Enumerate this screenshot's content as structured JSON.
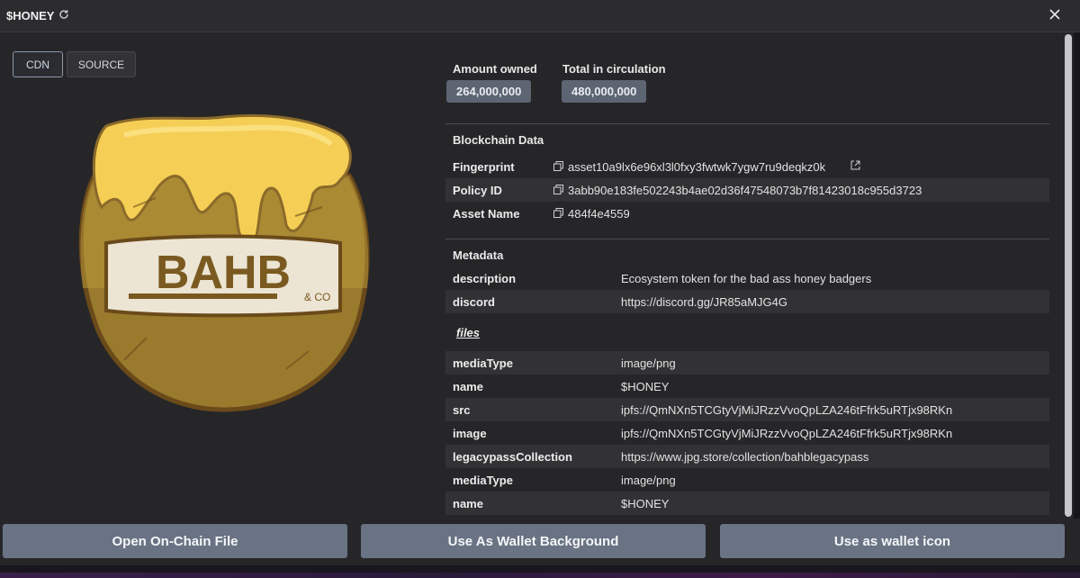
{
  "header": {
    "title": "$HONEY",
    "refresh_icon": "refresh-icon",
    "close_icon": "close-icon"
  },
  "view_toggle": {
    "cdn_label": "CDN",
    "source_label": "SOURCE",
    "selected": "CDN"
  },
  "preview": {
    "logo_text": "BAHB",
    "logo_subtext": "& CO"
  },
  "stats": {
    "amount_owned_label": "Amount owned",
    "amount_owned_value": "264,000,000",
    "total_circulation_label": "Total in circulation",
    "total_circulation_value": "480,000,000"
  },
  "blockchain": {
    "heading": "Blockchain Data",
    "fingerprint_label": "Fingerprint",
    "fingerprint_value": "asset10a9lx6e96xl3l0fxy3fwtwk7ygw7ru9deqkz0k",
    "policy_label": "Policy ID",
    "policy_value": "3abb90e183fe502243b4ae02d36f47548073b7f81423018c955d3723",
    "asset_name_label": "Asset Name",
    "asset_name_value": "484f4e4559"
  },
  "metadata": {
    "heading": "Metadata",
    "rows": [
      {
        "key": "description",
        "value": "Ecosystem token for the bad ass honey badgers"
      },
      {
        "key": "discord",
        "value": "https://discord.gg/JR85aMJG4G"
      }
    ],
    "files_label": "files",
    "file_rows": [
      {
        "key": "mediaType",
        "value": "image/png"
      },
      {
        "key": "name",
        "value": "$HONEY"
      },
      {
        "key": "src",
        "value": "ipfs://QmNXn5TCGtyVjMiJRzzVvoQpLZA246tFfrk5uRTjx98RKn"
      },
      {
        "key": "image",
        "value": "ipfs://QmNXn5TCGtyVjMiJRzzVvoQpLZA246tFfrk5uRTjx98RKn"
      },
      {
        "key": "legacypassCollection",
        "value": "https://www.jpg.store/collection/bahblegacypass"
      },
      {
        "key": "mediaType",
        "value": "image/png"
      },
      {
        "key": "name",
        "value": "$HONEY"
      }
    ]
  },
  "actions": {
    "open_file": "Open On-Chain File",
    "wallet_background": "Use As Wallet Background",
    "wallet_icon": "Use as wallet icon"
  },
  "colors": {
    "button_bg": "#6a7383",
    "stat_bg": "#5d6573",
    "honey": "#f5cf55",
    "pot": "#8b6a2a"
  }
}
